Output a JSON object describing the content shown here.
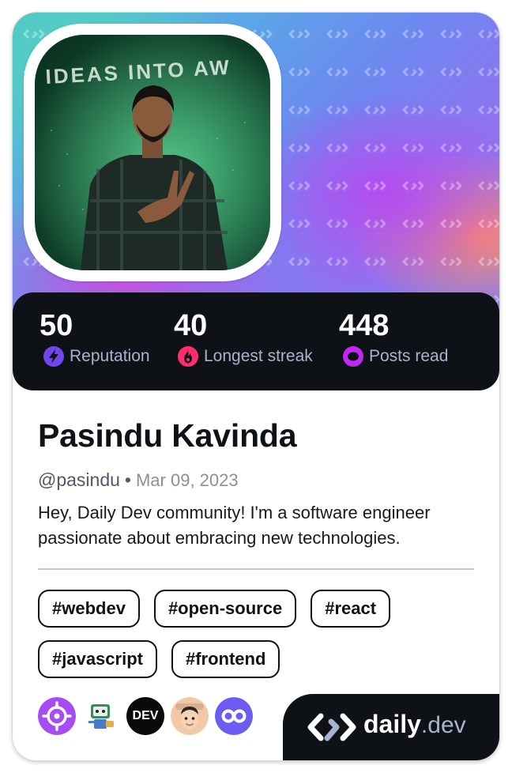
{
  "profile": {
    "name": "Pasindu Kavinda",
    "handle": "@pasindu",
    "separator": "•",
    "joined": "Mar 09, 2023",
    "bio": "Hey, Daily Dev community! I'm a software engineer passionate about embracing new technologies.",
    "avatar_backdrop_text": "IDEAS INTO AW"
  },
  "stats": [
    {
      "value": "50",
      "label": "Reputation",
      "icon": "lightning-icon",
      "color": "#7147ed"
    },
    {
      "value": "40",
      "label": "Longest streak",
      "icon": "flame-icon",
      "color": "#ff2d6e"
    },
    {
      "value": "448",
      "label": "Posts read",
      "icon": "eye-icon",
      "color": "#c029f0"
    }
  ],
  "tags": [
    "#webdev",
    "#open-source",
    "#react",
    "#javascript",
    "#frontend"
  ],
  "squads": [
    {
      "icon": "crosshair-squad-icon",
      "color": "#a54cf5"
    },
    {
      "icon": "robot-squad-icon",
      "color": "#e8f1ec"
    },
    {
      "icon": "dev-squad-icon",
      "color": "#0a0a0a",
      "text": "DEV"
    },
    {
      "icon": "memoji-squad-icon",
      "color": "#f2c9a8"
    },
    {
      "icon": "infinity-squad-icon",
      "color": "#6d5cf2"
    }
  ],
  "brand": {
    "name": "daily",
    "suffix": ".dev"
  },
  "colors": {
    "card_dark": "#0e1217",
    "label_gray": "#a8b3cf",
    "text_dark": "#0e1217"
  }
}
